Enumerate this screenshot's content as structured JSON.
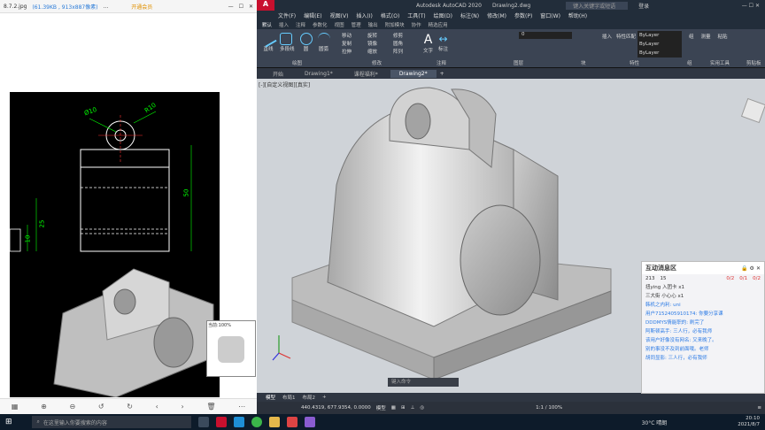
{
  "viewer": {
    "filename": "8.7.2.jpg",
    "fileinfo": "(61.39KB , 913x887像素)",
    "more": "...",
    "vip": "开通会员",
    "zoom_label": "当前:100%",
    "dims": {
      "d10": "Ø10",
      "r10": "R10",
      "h50": "50",
      "h25": "25",
      "h10": "10"
    }
  },
  "acad": {
    "app_title": "Autodesk AutoCAD 2020",
    "doc_title": "Drawing2.dwg",
    "search_placeholder": "键入关键字或短语",
    "login": "登录",
    "menu": [
      "文件(F)",
      "编辑(E)",
      "视图(V)",
      "插入(I)",
      "格式(O)",
      "工具(T)",
      "绘图(D)",
      "标注(N)",
      "修改(M)",
      "参数(P)",
      "窗口(W)",
      "帮助(H)"
    ],
    "ribbon_tabs": [
      "默认",
      "插入",
      "注释",
      "参数化",
      "视图",
      "管理",
      "输出",
      "附加模块",
      "协作",
      "精选应用"
    ],
    "draw_tools": [
      "直线",
      "多段线",
      "圆",
      "圆弧"
    ],
    "modify_tools": [
      "移动",
      "旋转",
      "修剪",
      "复制",
      "镜像",
      "圆角",
      "拉伸",
      "缩放",
      "阵列"
    ],
    "annotation_tools": [
      "文字",
      "标注"
    ],
    "layer_value": "0",
    "bylayer": [
      "ByLayer",
      "ByLayer",
      "ByLayer"
    ],
    "panel_labels": [
      "绘图",
      "修改",
      "注释",
      "图层",
      "块",
      "特性",
      "组",
      "实用工具",
      "剪贴板"
    ],
    "right_tools": [
      "插入",
      "特性匹配",
      "组",
      "测量",
      "粘贴"
    ],
    "doc_tabs": [
      "开始",
      "Drawing1*",
      "课程福利*",
      "Drawing2*"
    ],
    "viewport_label": "[-][自定义视图][真实]",
    "layout_tabs": [
      "模型",
      "布局1",
      "布局2"
    ],
    "coords": "440.4319, 677.9354, 0.0000",
    "model": "模型",
    "scale": "1:1 / 100%",
    "cmd_placeholder": "键入命令"
  },
  "chat": {
    "title": "互动消息区",
    "likes": "213",
    "count": "15",
    "gifts": [
      "0/2",
      "0/1",
      "0/2"
    ],
    "lines": [
      "扭ying 入团卡 x1",
      "三大街 小心心 x1",
      "韩机之内利: uni",
      "用户7152405910174: 你要分享课",
      "DDDMYS情能职的: 刷完了",
      "阿斯顿高手: 三人行，必有我师",
      "该用户好像没有网名: 又来晚了。",
      "别的事没不及到前面哦。老师",
      "胡同显影: 三人行，必有我师"
    ]
  },
  "taskbar": {
    "search_placeholder": "在这里输入你要搜索的内容",
    "weather": "30°C 晴朗",
    "time": "20:10",
    "date": "2021/8/7"
  }
}
